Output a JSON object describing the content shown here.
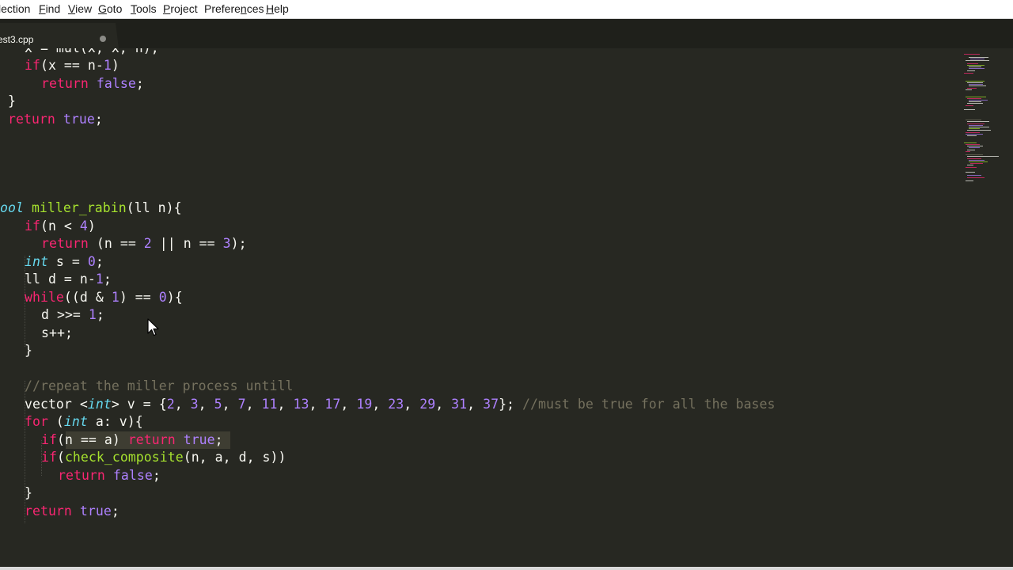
{
  "menu": {
    "items": [
      {
        "label": "lection",
        "pre": "",
        "u": "",
        "post": "lection"
      },
      {
        "label": "Find",
        "pre": "",
        "u": "F",
        "post": "ind"
      },
      {
        "label": "View",
        "pre": "",
        "u": "V",
        "post": "iew"
      },
      {
        "label": "Goto",
        "pre": "",
        "u": "G",
        "post": "oto"
      },
      {
        "label": "Tools",
        "pre": "",
        "u": "T",
        "post": "ools"
      },
      {
        "label": "Project",
        "pre": "",
        "u": "P",
        "post": "roject"
      },
      {
        "label": "Preferences",
        "pre": "Prefere",
        "u": "n",
        "post": "ces"
      },
      {
        "label": "Help",
        "pre": "",
        "u": "H",
        "post": "elp"
      }
    ]
  },
  "tab": {
    "label": "est3.cpp",
    "modified": true
  },
  "colors": {
    "background": "#272822",
    "keyword": "#f92672",
    "number": "#ae81ff",
    "function": "#a6e22e",
    "type": "#66d9ef",
    "comment": "#75715e",
    "text": "#f8f8f2"
  },
  "code": {
    "lines": [
      [
        [
          "x = mul(x, x, n);",
          "p"
        ]
      ],
      [
        [
          "if",
          "k"
        ],
        [
          "(x == n-",
          "p"
        ],
        [
          "1",
          "n"
        ],
        [
          ")",
          "p"
        ]
      ],
      [
        [
          "return",
          "k"
        ],
        [
          " ",
          "p"
        ],
        [
          "false",
          "n"
        ],
        [
          ";",
          "p"
        ]
      ],
      [
        [
          "}",
          "p"
        ]
      ],
      [
        [
          "return",
          "k"
        ],
        [
          " ",
          "p"
        ],
        [
          "true",
          "n"
        ],
        [
          ";",
          "p"
        ]
      ],
      [
        [
          "",
          "p"
        ]
      ],
      [
        [
          "",
          "p"
        ]
      ],
      [
        [
          "",
          "p"
        ]
      ],
      [
        [
          "",
          "p"
        ]
      ],
      [
        [
          "ool",
          "t"
        ],
        [
          " ",
          "p"
        ],
        [
          "miller_rabin",
          "f"
        ],
        [
          "(ll n){",
          "p"
        ]
      ],
      [
        [
          "if",
          "k"
        ],
        [
          "(n < ",
          "p"
        ],
        [
          "4",
          "n"
        ],
        [
          ")",
          "p"
        ]
      ],
      [
        [
          "return",
          "k"
        ],
        [
          " (n == ",
          "p"
        ],
        [
          "2",
          "n"
        ],
        [
          " || n == ",
          "p"
        ],
        [
          "3",
          "n"
        ],
        [
          ");",
          "p"
        ]
      ],
      [
        [
          "int",
          "t"
        ],
        [
          " s = ",
          "p"
        ],
        [
          "0",
          "n"
        ],
        [
          ";",
          "p"
        ]
      ],
      [
        [
          "ll d = n-",
          "p"
        ],
        [
          "1",
          "n"
        ],
        [
          ";",
          "p"
        ]
      ],
      [
        [
          "while",
          "k"
        ],
        [
          "((d & ",
          "p"
        ],
        [
          "1",
          "n"
        ],
        [
          ") == ",
          "p"
        ],
        [
          "0",
          "n"
        ],
        [
          "){",
          "p"
        ]
      ],
      [
        [
          "d >>= ",
          "p"
        ],
        [
          "1",
          "n"
        ],
        [
          ";",
          "p"
        ]
      ],
      [
        [
          "s++;",
          "p"
        ]
      ],
      [
        [
          "}",
          "p"
        ]
      ],
      [
        [
          "",
          "p"
        ]
      ],
      [
        [
          "//repeat the miller process untill",
          "c"
        ]
      ],
      [
        [
          "vector <",
          "p"
        ],
        [
          "int",
          "t"
        ],
        [
          "> v = {",
          "p"
        ],
        [
          "2",
          "n"
        ],
        [
          ", ",
          "p"
        ],
        [
          "3",
          "n"
        ],
        [
          ", ",
          "p"
        ],
        [
          "5",
          "n"
        ],
        [
          ", ",
          "p"
        ],
        [
          "7",
          "n"
        ],
        [
          ", ",
          "p"
        ],
        [
          "11",
          "n"
        ],
        [
          ", ",
          "p"
        ],
        [
          "13",
          "n"
        ],
        [
          ", ",
          "p"
        ],
        [
          "17",
          "n"
        ],
        [
          ", ",
          "p"
        ],
        [
          "19",
          "n"
        ],
        [
          ", ",
          "p"
        ],
        [
          "23",
          "n"
        ],
        [
          ", ",
          "p"
        ],
        [
          "29",
          "n"
        ],
        [
          ", ",
          "p"
        ],
        [
          "31",
          "n"
        ],
        [
          ", ",
          "p"
        ],
        [
          "37",
          "n"
        ],
        [
          "}; ",
          "p"
        ],
        [
          "//must be true for all the bases",
          "c"
        ]
      ],
      [
        [
          "for",
          "k"
        ],
        [
          " (",
          "p"
        ],
        [
          "int",
          "t"
        ],
        [
          " a: v){",
          "p"
        ]
      ],
      [
        [
          "if",
          "k"
        ],
        [
          "(n == a) ",
          "p"
        ],
        [
          "return",
          "k"
        ],
        [
          " ",
          "p"
        ],
        [
          "true",
          "n"
        ],
        [
          ";",
          "p"
        ]
      ],
      [
        [
          "if",
          "k"
        ],
        [
          "(",
          "p"
        ],
        [
          "check_composite",
          "f"
        ],
        [
          "(n, a, d, s))",
          "p"
        ]
      ],
      [
        [
          "return",
          "k"
        ],
        [
          " ",
          "p"
        ],
        [
          "false",
          "n"
        ],
        [
          ";",
          "p"
        ]
      ],
      [
        [
          "}",
          "p"
        ]
      ],
      [
        [
          "return",
          "k"
        ],
        [
          " ",
          "p"
        ],
        [
          "true",
          "n"
        ],
        [
          ";",
          "p"
        ]
      ]
    ]
  }
}
